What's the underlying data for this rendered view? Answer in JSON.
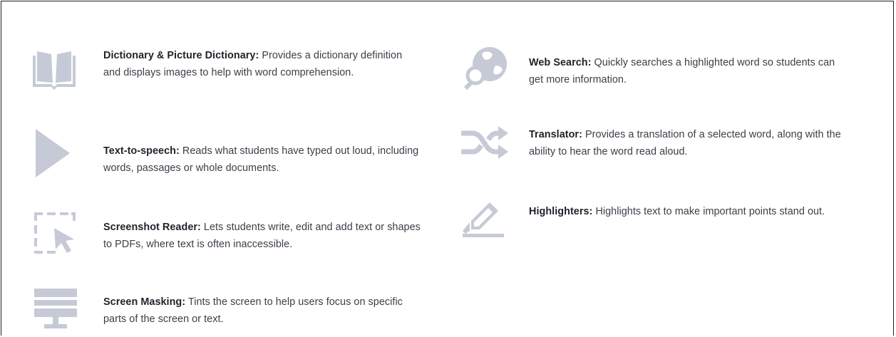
{
  "features_left": [
    {
      "id": "dictionary",
      "icon": "book-icon",
      "title": "Dictionary & Picture Dictionary:",
      "desc": " Provides a dictionary definition and displays images to help with word comprehension."
    },
    {
      "id": "text-to-speech",
      "icon": "play-icon",
      "title": "Text-to-speech:",
      "desc": " Reads what students have typed out loud, including words, passages or whole documents."
    },
    {
      "id": "screenshot-reader",
      "icon": "screenshot-cursor-icon",
      "title": "Screenshot Reader:",
      "desc": " Lets students write, edit and add text or shapes to PDFs, where text is often inaccessible."
    },
    {
      "id": "screen-masking",
      "icon": "monitor-icon",
      "title": "Screen Masking:",
      "desc": " Tints the screen to help users focus on specific parts of the screen or text."
    }
  ],
  "features_right": [
    {
      "id": "web-search",
      "icon": "globe-search-icon",
      "title": "Web Search:",
      "desc": " Quickly searches a highlighted word so students can get more information."
    },
    {
      "id": "translator",
      "icon": "shuffle-icon",
      "title": "Translator:",
      "desc": " Provides a translation of a selected word, along with the ability to hear the word read aloud."
    },
    {
      "id": "highlighters",
      "icon": "highlighter-icon",
      "title": "Highlighters:",
      "desc": " Highlights text to make important points stand out."
    }
  ],
  "colors": {
    "icon": "#c5cad6",
    "title": "#1f2329",
    "body": "#3a3f47",
    "border": "#1f1f1f"
  }
}
